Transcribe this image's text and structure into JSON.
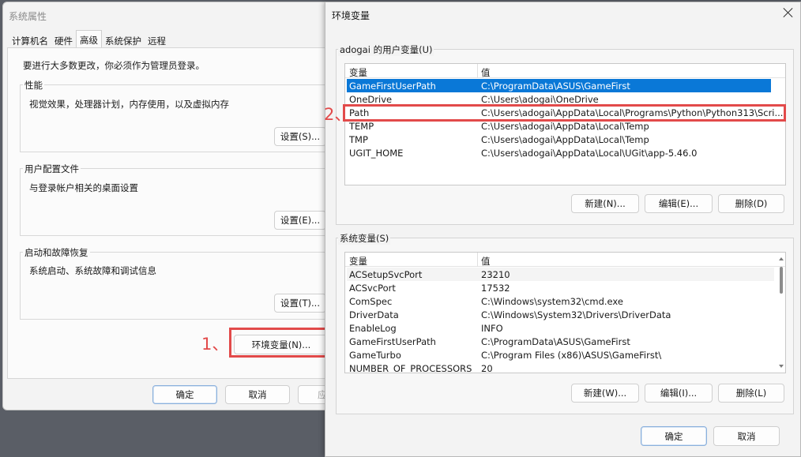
{
  "system_properties": {
    "title": "系统属性",
    "tabs": [
      "计算机名",
      "硬件",
      "高级",
      "系统保护",
      "远程"
    ],
    "active_tab": "高级",
    "admin_note": "要进行大多数更改，你必须作为管理员登录。",
    "performance": {
      "title": "性能",
      "desc": "视觉效果，处理器计划，内存使用，以及虚拟内存",
      "button": "设置(S)..."
    },
    "user_profiles": {
      "title": "用户配置文件",
      "desc": "与登录帐户相关的桌面设置",
      "button": "设置(E)..."
    },
    "startup_recovery": {
      "title": "启动和故障恢复",
      "desc": "系统启动、系统故障和调试信息",
      "button": "设置(T)..."
    },
    "env_button": "环境变量(N)...",
    "ok": "确定",
    "cancel": "取消",
    "apply": "应"
  },
  "annotations": {
    "step1": "1、",
    "step2": "2、",
    "highlight_color": "#e24a4a"
  },
  "env_vars": {
    "title": "环境变量",
    "user_section": {
      "title": "adogai 的用户变量(U)",
      "col_var": "变量",
      "col_val": "值",
      "rows": [
        {
          "name": "GameFirstUserPath",
          "value": "C:\\ProgramData\\ASUS\\GameFirst"
        },
        {
          "name": "OneDrive",
          "value": "C:\\Users\\adogai\\OneDrive"
        },
        {
          "name": "Path",
          "value": "C:\\Users\\adogai\\AppData\\Local\\Programs\\Python\\Python313\\Scri..."
        },
        {
          "name": "TEMP",
          "value": "C:\\Users\\adogai\\AppData\\Local\\Temp"
        },
        {
          "name": "TMP",
          "value": "C:\\Users\\adogai\\AppData\\Local\\Temp"
        },
        {
          "name": "UGIT_HOME",
          "value": "C:\\Users\\adogai\\AppData\\Local\\UGit\\app-5.46.0"
        }
      ],
      "selected_row": "GameFirstUserPath",
      "new": "新建(N)...",
      "edit": "编辑(E)...",
      "delete": "删除(D)"
    },
    "system_section": {
      "title": "系统变量(S)",
      "col_var": "变量",
      "col_val": "值",
      "rows": [
        {
          "name": "ACSetupSvcPort",
          "value": "23210"
        },
        {
          "name": "ACSvcPort",
          "value": "17532"
        },
        {
          "name": "ComSpec",
          "value": "C:\\Windows\\system32\\cmd.exe"
        },
        {
          "name": "DriverData",
          "value": "C:\\Windows\\System32\\Drivers\\DriverData"
        },
        {
          "name": "EnableLog",
          "value": "INFO"
        },
        {
          "name": "GameFirstUserPath",
          "value": "C:\\ProgramData\\ASUS\\GameFirst"
        },
        {
          "name": "GameTurbo",
          "value": "C:\\Program Files (x86)\\ASUS\\GameFirst\\"
        },
        {
          "name": "NUMBER_OF_PROCESSORS",
          "value": "20"
        }
      ],
      "new": "新建(W)...",
      "edit": "编辑(I)...",
      "delete": "删除(L)"
    },
    "ok": "确定",
    "cancel": "取消",
    "accent_color": "#0a78d7"
  }
}
